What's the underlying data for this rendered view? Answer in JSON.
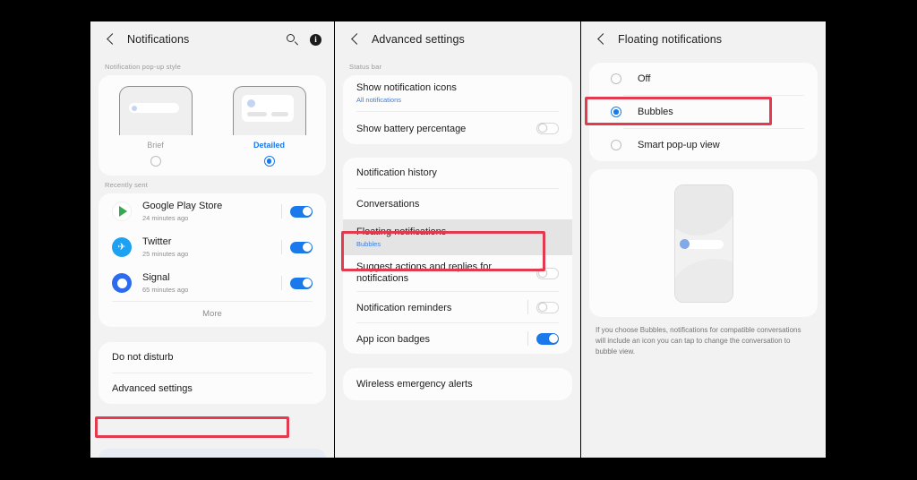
{
  "panel1": {
    "header": {
      "title": "Notifications",
      "back_icon": "back-chevron-icon",
      "search_icon": "search-icon",
      "info_icon": "info-icon",
      "info_glyph": "i"
    },
    "popup_style": {
      "label": "Notification pop-up style",
      "options": [
        {
          "name": "Brief",
          "selected": false
        },
        {
          "name": "Detailed",
          "selected": true
        }
      ]
    },
    "recently_sent": {
      "label": "Recently sent",
      "apps": [
        {
          "name": "Google Play Store",
          "time": "24 minutes ago",
          "toggle": "on",
          "icon": "google-play-icon"
        },
        {
          "name": "Twitter",
          "time": "25 minutes ago",
          "toggle": "on",
          "icon": "twitter-icon"
        },
        {
          "name": "Signal",
          "time": "65 minutes ago",
          "toggle": "on",
          "icon": "signal-icon"
        }
      ],
      "more_label": "More"
    },
    "bottom_rows": [
      {
        "label": "Do not disturb",
        "highlighted": false
      },
      {
        "label": "Advanced settings",
        "highlighted": true
      }
    ]
  },
  "panel2": {
    "header": {
      "title": "Advanced settings",
      "back_icon": "back-chevron-icon"
    },
    "status_bar": {
      "label": "Status bar",
      "rows": [
        {
          "label": "Show notification icons",
          "sublabel": "All notifications",
          "control": "none"
        },
        {
          "label": "Show battery percentage",
          "sublabel": "",
          "control": "toggle-off"
        }
      ]
    },
    "rows": [
      {
        "label": "Notification history",
        "sublabel": "",
        "control": "none",
        "highlighted": false,
        "selected": false
      },
      {
        "label": "Conversations",
        "sublabel": "",
        "control": "none",
        "highlighted": false,
        "selected": false
      },
      {
        "label": "Floating notifications",
        "sublabel": "Bubbles",
        "control": "none",
        "highlighted": true,
        "selected": true
      },
      {
        "label": "Suggest actions and replies for notifications",
        "sublabel": "",
        "control": "toggle-off",
        "highlighted": false,
        "selected": false
      },
      {
        "label": "Notification reminders",
        "sublabel": "",
        "control": "toggle-off-divider",
        "highlighted": false,
        "selected": false
      },
      {
        "label": "App icon badges",
        "sublabel": "",
        "control": "toggle-on-divider",
        "highlighted": false,
        "selected": false
      }
    ],
    "last_card": {
      "label": "Wireless emergency alerts"
    }
  },
  "panel3": {
    "header": {
      "title": "Floating notifications",
      "back_icon": "back-chevron-icon"
    },
    "options": [
      {
        "label": "Off",
        "selected": false,
        "highlighted": false
      },
      {
        "label": "Bubbles",
        "selected": true,
        "highlighted": true
      },
      {
        "label": "Smart pop-up view",
        "selected": false,
        "highlighted": false
      }
    ],
    "illustration": "phone-bubble-preview-illustration",
    "description": "If you choose Bubbles, notifications for compatible conversations will include an icon you can tap to change the conversation to bubble view."
  },
  "colors": {
    "accent_blue": "#1a7aeb",
    "highlight_red": "#e23a4e",
    "panel_bg": "#f2f2f2",
    "card_bg": "#fcfcfc",
    "backdrop": "#000000"
  }
}
